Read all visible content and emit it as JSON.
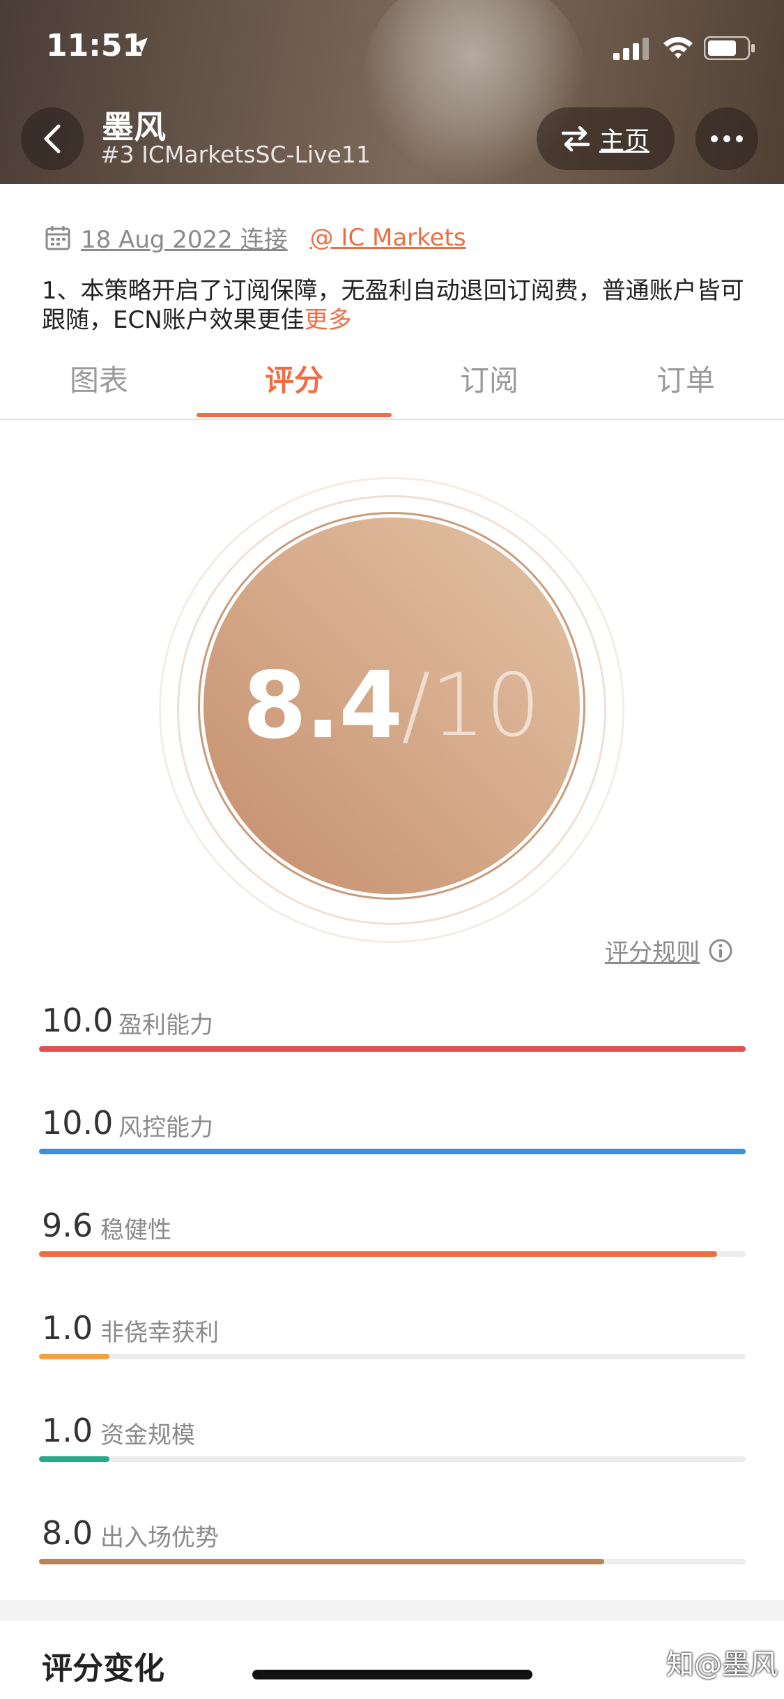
{
  "status": {
    "time": "11:51"
  },
  "header": {
    "name": "墨风",
    "account": "#3 ICMarketsSC-Live11",
    "home_label": "主页"
  },
  "info": {
    "date": "18 Aug 2022 连接",
    "broker": "@ IC Markets",
    "description": "1、本策略开启了订阅保障，无盈利自动退回订阅费，普通账户皆可跟随，ECN账户效果更佳",
    "more": "更多"
  },
  "tabs": [
    {
      "label": "图表"
    },
    {
      "label": "评分"
    },
    {
      "label": "订阅"
    },
    {
      "label": "订单"
    }
  ],
  "active_tab": "评分",
  "score": {
    "value": "8.4",
    "max": "/10",
    "rule_label": "评分规则"
  },
  "metrics": [
    {
      "value": "10.0",
      "label": "盈利能力",
      "fraction": 1.0,
      "color": "#e0514f"
    },
    {
      "value": "10.0",
      "label": "风控能力",
      "fraction": 1.0,
      "color": "#3e8ee0"
    },
    {
      "value": "9.6",
      "label": "稳健性",
      "fraction": 0.96,
      "color": "#ee6e43"
    },
    {
      "value": "1.0",
      "label": "非侥幸获利",
      "fraction": 0.1,
      "color": "#f0a33c"
    },
    {
      "value": "1.0",
      "label": "资金规模",
      "fraction": 0.1,
      "color": "#27a98a"
    },
    {
      "value": "8.0",
      "label": "出入场优势",
      "fraction": 0.8,
      "color": "#b8835a"
    }
  ],
  "section": {
    "title": "评分变化"
  },
  "watermark": "知@墨风"
}
